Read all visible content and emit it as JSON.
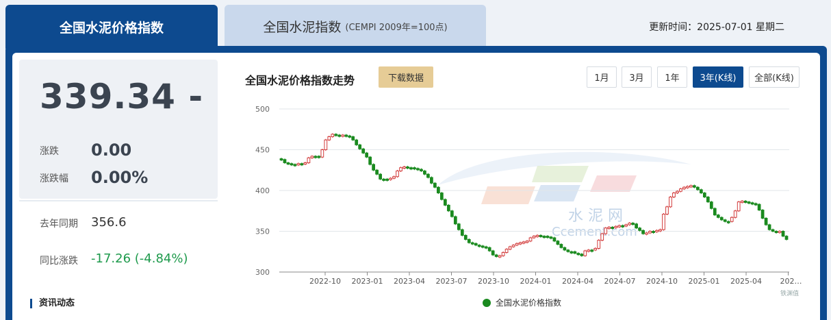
{
  "tabs": {
    "active_label": "全国水泥价格指数",
    "inactive_label": "全国水泥指数",
    "inactive_sub": "(CEMPI 2009年=100点)"
  },
  "update": {
    "label": "更新时间：2025-07-01 星期二"
  },
  "summary": {
    "index_value": "339.34 -",
    "change_label": "涨跌",
    "change_value": "0.00",
    "pct_label": "涨跌幅",
    "pct_value": "0.00%",
    "last_year_label": "去年同期",
    "last_year_value": "356.6",
    "yoy_label": "同比涨跌",
    "yoy_value": "-17.26 (-4.84%)"
  },
  "news": {
    "label": "资讯动态"
  },
  "chart_header": {
    "title": "全国水泥价格指数走势",
    "download_label": "下载数据",
    "ranges": [
      "1月",
      "3月",
      "1年",
      "3年(K线)",
      "全部(K线)"
    ],
    "active_range": "3年(K线)"
  },
  "watermark": {
    "text": "水 泥 网",
    "sub": "Ccement.com"
  },
  "badge": {
    "text": "铁渊值"
  },
  "colors": {
    "up": "#d23a3a",
    "down": "#1a8a1f",
    "accent": "#0d4a8f"
  },
  "chart_data": {
    "type": "candlestick",
    "series_name": "全国水泥价格指数",
    "ylim": [
      300,
      500
    ],
    "yticks": [
      300,
      350,
      400,
      450,
      500
    ],
    "x_ticks": [
      "2022-10",
      "2023-01",
      "2023-04",
      "2023-07",
      "2023-10",
      "2024-01",
      "2024-04",
      "2024-07",
      "2024-10",
      "2025-01",
      "2025-04",
      "202…"
    ],
    "values": [
      438,
      434,
      433,
      432,
      432,
      433,
      433,
      434,
      440,
      442,
      442,
      441,
      450,
      462,
      466,
      469,
      468,
      467,
      468,
      467,
      466,
      462,
      456,
      451,
      446,
      441,
      432,
      425,
      420,
      414,
      414,
      414,
      415,
      417,
      424,
      428,
      429,
      428,
      428,
      427,
      426,
      424,
      420,
      416,
      409,
      404,
      397,
      389,
      382,
      375,
      368,
      359,
      352,
      345,
      340,
      336,
      335,
      333,
      332,
      331,
      330,
      326,
      321,
      319,
      320,
      324,
      328,
      331,
      333,
      335,
      336,
      337,
      338,
      342,
      344,
      345,
      344,
      344,
      343,
      342,
      338,
      334,
      330,
      327,
      325,
      325,
      323,
      322,
      320,
      326,
      327,
      327,
      329,
      339,
      347,
      354,
      355,
      355,
      356,
      357,
      357,
      358,
      360,
      359,
      354,
      351,
      347,
      348,
      350,
      350,
      351,
      352,
      371,
      380,
      392,
      397,
      399,
      402,
      404,
      405,
      406,
      404,
      401,
      397,
      392,
      386,
      378,
      370,
      367,
      364,
      362,
      362,
      367,
      375,
      386,
      387,
      386,
      385,
      384,
      383,
      376,
      366,
      358,
      352,
      350,
      349,
      350,
      344,
      340
    ]
  }
}
